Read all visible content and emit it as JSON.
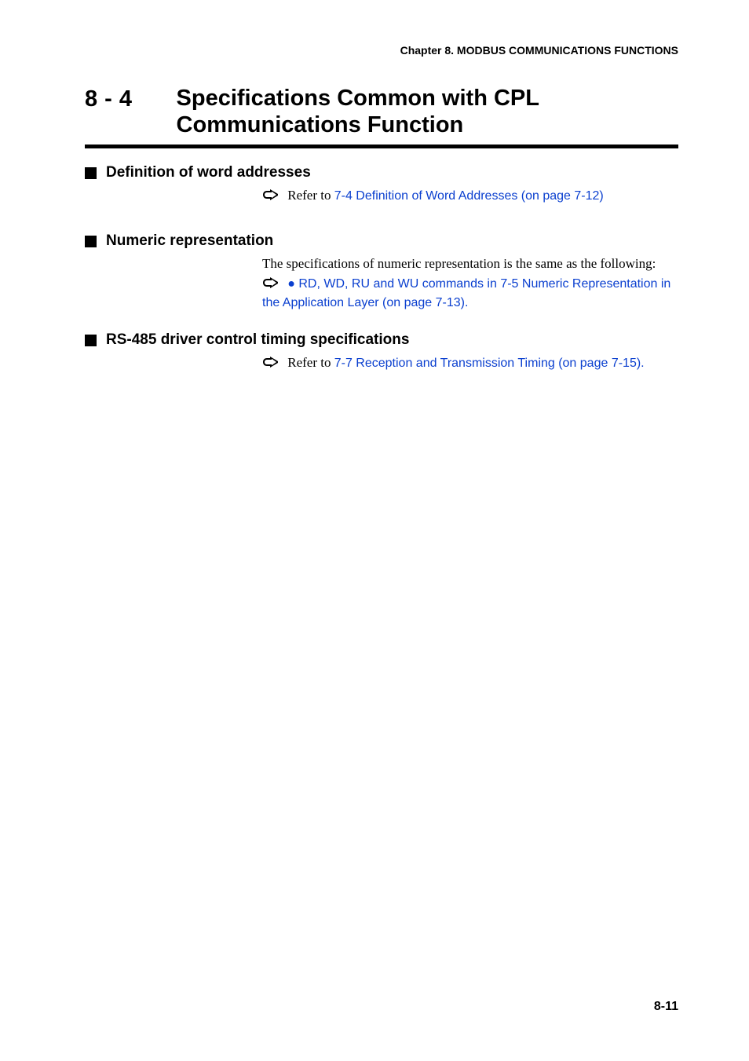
{
  "running_head": "Chapter 8. MODBUS COMMUNICATIONS FUNCTIONS",
  "section_number": "8  -  4",
  "section_title_line1": "Specifications Common with CPL",
  "section_title_line2": "Communications Function",
  "sub1": {
    "heading": "Definition of word addresses",
    "refer_prefix": "Refer to ",
    "ref_link": "7-4 Definition of Word Addresses (on page 7-12)"
  },
  "sub2": {
    "heading": "Numeric representation",
    "body_text": "The specifications of numeric representation is the same as the following:",
    "ref_bullet": "●",
    "ref_link_l1": "RD, WD, RU and WU commands in 7-5 Numeric Representation in",
    "ref_link_l2": "the Application Layer (on page 7-13)",
    "ref_trailing": "."
  },
  "sub3": {
    "heading": "RS-485 driver control timing specifications",
    "refer_prefix": "Refer to ",
    "ref_link": "7-7 Reception and Transmission Timing (on page 7-15)",
    "ref_trailing": "."
  },
  "page_number": "8-11"
}
